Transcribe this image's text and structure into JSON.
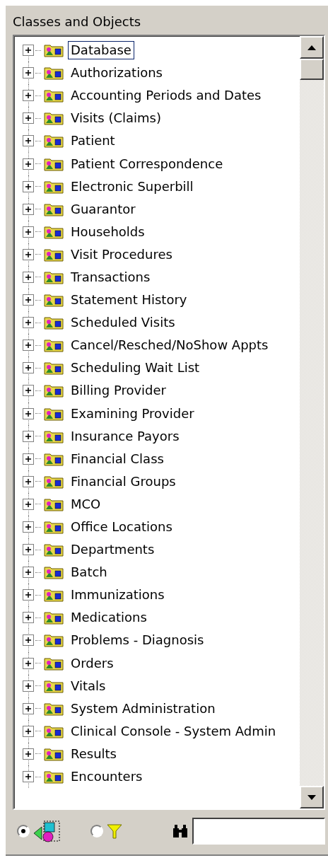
{
  "panel": {
    "title": "Classes and Objects"
  },
  "tree": {
    "items": [
      {
        "label": "Database",
        "expanded": false,
        "focused": true
      },
      {
        "label": "Authorizations",
        "expanded": false,
        "focused": false
      },
      {
        "label": "Accounting Periods and Dates",
        "expanded": false,
        "focused": false
      },
      {
        "label": "Visits (Claims)",
        "expanded": false,
        "focused": false
      },
      {
        "label": "Patient",
        "expanded": false,
        "focused": false
      },
      {
        "label": "Patient Correspondence",
        "expanded": false,
        "focused": false
      },
      {
        "label": "Electronic Superbill",
        "expanded": false,
        "focused": false
      },
      {
        "label": "Guarantor",
        "expanded": false,
        "focused": false
      },
      {
        "label": "Households",
        "expanded": false,
        "focused": false
      },
      {
        "label": "Visit Procedures",
        "expanded": false,
        "focused": false
      },
      {
        "label": "Transactions",
        "expanded": false,
        "focused": false
      },
      {
        "label": "Statement History",
        "expanded": false,
        "focused": false
      },
      {
        "label": "Scheduled Visits",
        "expanded": false,
        "focused": false
      },
      {
        "label": "Cancel/Resched/NoShow Appts",
        "expanded": false,
        "focused": false
      },
      {
        "label": "Scheduling Wait List",
        "expanded": false,
        "focused": false
      },
      {
        "label": "Billing Provider",
        "expanded": false,
        "focused": false
      },
      {
        "label": "Examining Provider",
        "expanded": false,
        "focused": false
      },
      {
        "label": "Insurance Payors",
        "expanded": false,
        "focused": false
      },
      {
        "label": "Financial Class",
        "expanded": false,
        "focused": false
      },
      {
        "label": "Financial Groups",
        "expanded": false,
        "focused": false
      },
      {
        "label": "MCO",
        "expanded": false,
        "focused": false
      },
      {
        "label": "Office Locations",
        "expanded": false,
        "focused": false
      },
      {
        "label": "Departments",
        "expanded": false,
        "focused": false
      },
      {
        "label": "Batch",
        "expanded": false,
        "focused": false
      },
      {
        "label": "Immunizations",
        "expanded": false,
        "focused": false
      },
      {
        "label": "Medications",
        "expanded": false,
        "focused": false
      },
      {
        "label": "Problems - Diagnosis",
        "expanded": false,
        "focused": false
      },
      {
        "label": "Orders",
        "expanded": false,
        "focused": false
      },
      {
        "label": "Vitals",
        "expanded": false,
        "focused": false
      },
      {
        "label": "System Administration",
        "expanded": false,
        "focused": false
      },
      {
        "label": "Clinical Console - System Admin",
        "expanded": false,
        "focused": false
      },
      {
        "label": "Results",
        "expanded": false,
        "focused": false
      },
      {
        "label": "Encounters",
        "expanded": false,
        "focused": false
      }
    ]
  },
  "view_options": [
    {
      "kind": "objects",
      "selected": true
    },
    {
      "kind": "filter",
      "selected": false
    }
  ]
}
